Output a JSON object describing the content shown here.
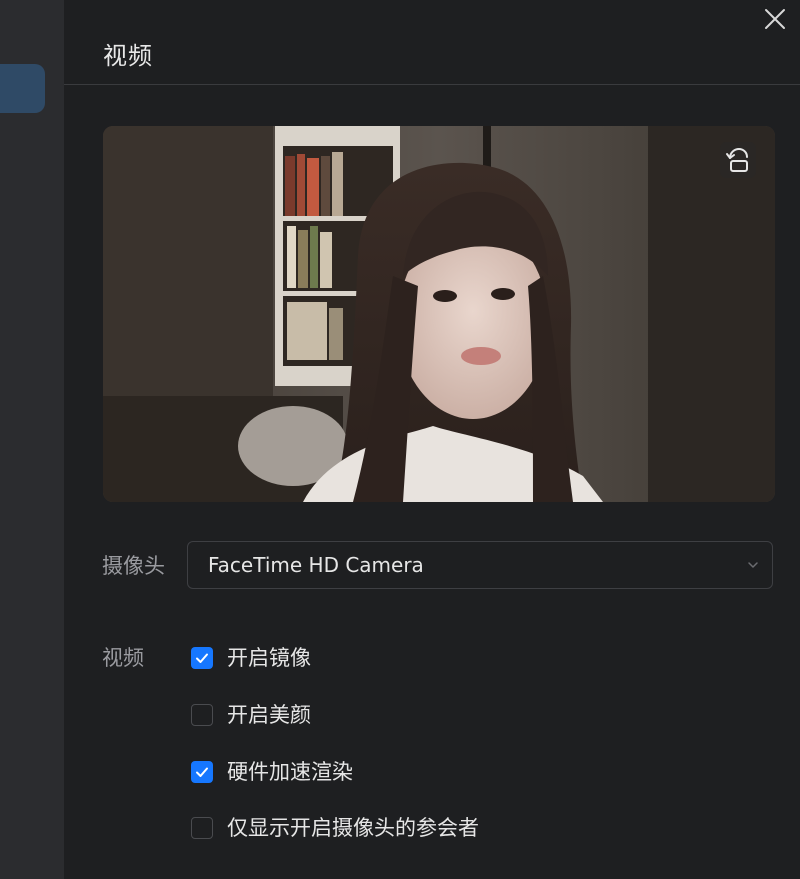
{
  "header": {
    "title": "视频"
  },
  "camera": {
    "label": "摄像头",
    "selected": "FaceTime HD Camera"
  },
  "video_settings": {
    "label": "视频",
    "options": [
      {
        "label": "开启镜像",
        "checked": true
      },
      {
        "label": "开启美颜",
        "checked": false
      },
      {
        "label": "硬件加速渲染",
        "checked": true
      },
      {
        "label": "仅显示开启摄像头的参会者",
        "checked": false
      }
    ]
  },
  "colors": {
    "accent": "#1677ff",
    "background": "#1e1f21",
    "sidebar": "#2b2c2f",
    "sidebar_active": "#2f4a66"
  },
  "icons": {
    "close": "close-icon",
    "rotate": "rotate-camera-icon",
    "dropdown": "chevron-down-icon",
    "check": "check-icon"
  }
}
